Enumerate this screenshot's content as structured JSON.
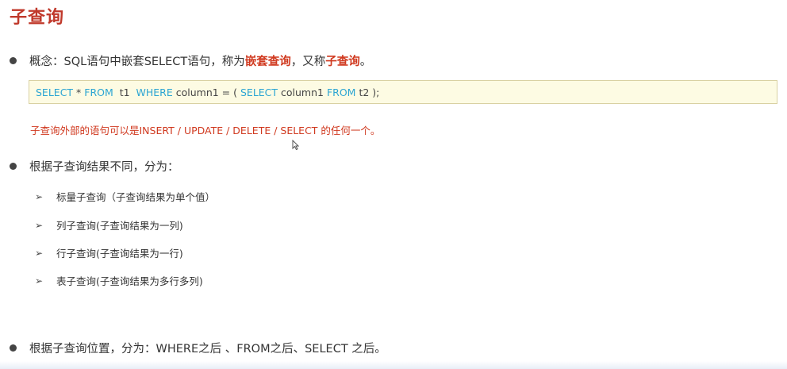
{
  "title": "子查询",
  "concept": {
    "prefix": "概念：SQL语句中嵌套SELECT语句，称为",
    "hl1": "嵌套查询",
    "mid": "，又称",
    "hl2": "子查询",
    "suffix": "。"
  },
  "code": {
    "t1": "SELECT",
    "t2": " * ",
    "t3": "FROM",
    "t4": "  t1  ",
    "t5": "WHERE",
    "t6": " column1 = ( ",
    "t7": "SELECT",
    "t8": " column1 ",
    "t9": "FROM",
    "t10": " t2 );"
  },
  "note": "子查询外部的语句可以是INSERT / UPDATE / DELETE / SELECT 的任何一个。",
  "classify_heading": "根据子查询结果不同，分为：",
  "classify_items": [
    "标量子查询（子查询结果为单个值）",
    "列子查询(子查询结果为一列)",
    "行子查询(子查询结果为一行)",
    "表子查询(子查询结果为多行多列)"
  ],
  "position_heading": "根据子查询位置，分为：WHERE之后 、FROM之后、SELECT 之后。",
  "colors": {
    "title": "#c0392b",
    "highlight": "#d0391f",
    "keyword": "#2ca5d3",
    "code_bg": "#fdfbe3"
  }
}
